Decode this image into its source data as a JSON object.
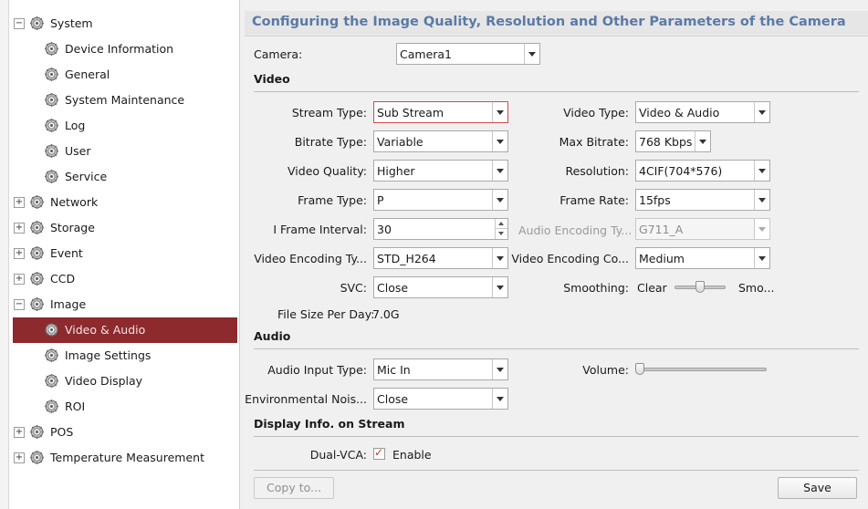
{
  "sidebar": {
    "items": [
      {
        "label": "System",
        "toggle": "−",
        "level": 1
      },
      {
        "label": "Device Information",
        "level": 2
      },
      {
        "label": "General",
        "level": 2
      },
      {
        "label": "System Maintenance",
        "level": 2
      },
      {
        "label": "Log",
        "level": 2
      },
      {
        "label": "User",
        "level": 2
      },
      {
        "label": "Service",
        "level": 2
      },
      {
        "label": "Network",
        "toggle": "+",
        "level": 1
      },
      {
        "label": "Storage",
        "toggle": "+",
        "level": 1
      },
      {
        "label": "Event",
        "toggle": "+",
        "level": 1
      },
      {
        "label": "CCD",
        "toggle": "+",
        "level": 1
      },
      {
        "label": "Image",
        "toggle": "−",
        "level": 1
      },
      {
        "label": "Video & Audio",
        "level": 2,
        "selected": true
      },
      {
        "label": "Image Settings",
        "level": 2
      },
      {
        "label": "Video Display",
        "level": 2
      },
      {
        "label": "ROI",
        "level": 2
      },
      {
        "label": "POS",
        "toggle": "+",
        "level": 1
      },
      {
        "label": "Temperature Measurement",
        "toggle": "+",
        "level": 1
      }
    ]
  },
  "header": {
    "title": "Configuring the Image Quality, Resolution and Other Parameters of the Camera"
  },
  "camera": {
    "label": "Camera:",
    "value": "Camera1"
  },
  "video": {
    "section": "Video",
    "stream_type": {
      "label": "Stream Type:",
      "value": "Sub Stream"
    },
    "video_type": {
      "label": "Video Type:",
      "value": "Video & Audio"
    },
    "bitrate_type": {
      "label": "Bitrate Type:",
      "value": "Variable"
    },
    "max_bitrate": {
      "label": "Max Bitrate:",
      "value": "768 Kbps"
    },
    "video_quality": {
      "label": "Video Quality:",
      "value": "Higher"
    },
    "resolution": {
      "label": "Resolution:",
      "value": "4CIF(704*576)"
    },
    "frame_type": {
      "label": "Frame Type:",
      "value": "P"
    },
    "frame_rate": {
      "label": "Frame Rate:",
      "value": "15fps"
    },
    "i_frame_interval": {
      "label": "I Frame Interval:",
      "value": "30"
    },
    "audio_encoding_type": {
      "label": "Audio Encoding Ty...",
      "value": "G711_A"
    },
    "video_encoding_type": {
      "label": "Video Encoding Ty...",
      "value": "STD_H264"
    },
    "video_encoding_complexity": {
      "label": "Video Encoding Co...",
      "value": "Medium"
    },
    "svc": {
      "label": "SVC:",
      "value": "Close"
    },
    "smoothing": {
      "label": "Smoothing:",
      "left_label": "Clear",
      "right_label": "Smo...",
      "level": 0.5
    },
    "file_size": {
      "label": "File Size Per Day:",
      "value": "7.0G"
    }
  },
  "audio": {
    "section": "Audio",
    "audio_input_type": {
      "label": "Audio Input Type:",
      "value": "Mic In"
    },
    "volume": {
      "label": "Volume:",
      "level": 0.0
    },
    "environmental_noise": {
      "label": "Environmental Nois...",
      "value": "Close"
    }
  },
  "display_info": {
    "section": "Display Info. on Stream",
    "dual_vca": {
      "label": "Dual-VCA:",
      "checkbox_label": "Enable",
      "checked": true,
      "check_glyph": "✓"
    }
  },
  "footer": {
    "copy_label": "Copy to...",
    "save_label": "Save"
  },
  "colors": {
    "selected_row": "#8c2a2e",
    "title": "#5a7aa6",
    "check": "#c0392b"
  }
}
